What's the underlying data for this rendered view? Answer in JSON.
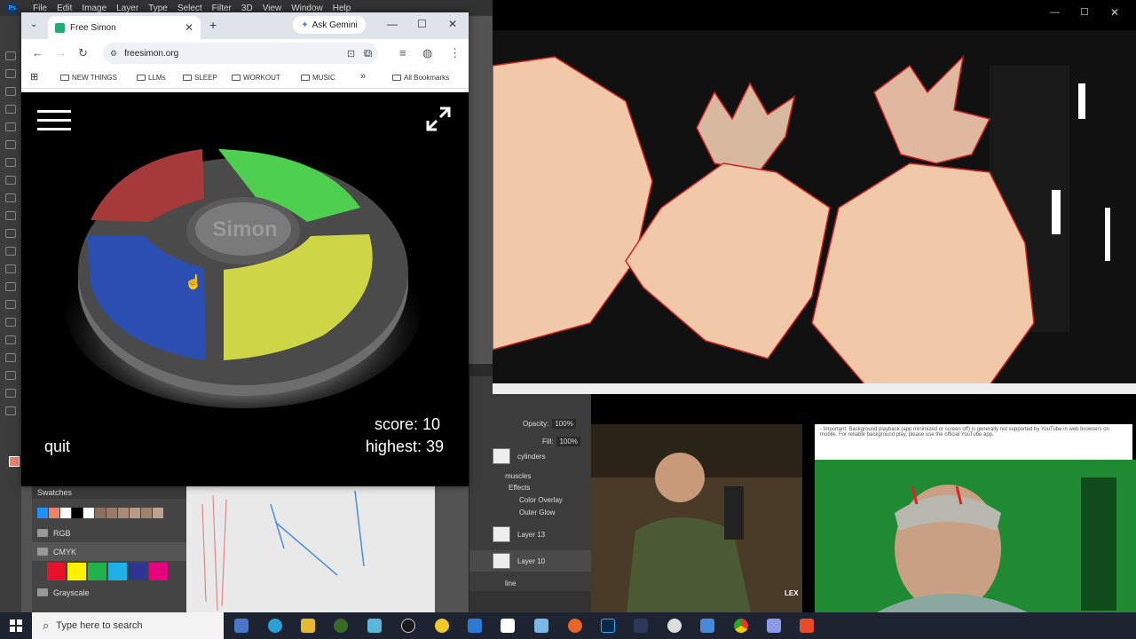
{
  "ps": {
    "menu": [
      "File",
      "Edit",
      "Image",
      "Layer",
      "Type",
      "Select",
      "Filter",
      "3D",
      "View",
      "Window",
      "Help"
    ],
    "swatches_title": "Swatches",
    "groups": [
      "RGB",
      "CMYK",
      "Grayscale"
    ],
    "layers": {
      "opacity_label": "Opacity:",
      "opacity_value": "100%",
      "fill_label": "Fill:",
      "fill_value": "100%",
      "items": [
        "cylinders",
        "muscles",
        "Effects",
        "Color Overlay",
        "Outer Glow",
        "Layer 13",
        "Layer 10",
        "line"
      ]
    }
  },
  "chrome": {
    "tab_title": "Free Simon",
    "gemini_label": "Ask Gemini",
    "url": "freesimon.org",
    "bookmarks": [
      "NEW THINGS",
      "LLMs",
      "SLEEP",
      "WORKOUT",
      "MUSIC"
    ],
    "all_bookmarks": "All Bookmarks"
  },
  "game": {
    "center_label": "Simon",
    "score_text": "score: 10",
    "highest_text": "highest: 39",
    "quit_label": "quit",
    "colors": {
      "red": "#a63a3a",
      "green": "#4fcf4f",
      "blue": "#2a4fb0",
      "yellow": "#cfd645"
    }
  },
  "video_text": "- Important: Background playback (app minimized or screen off) is generally not supported by YouTube in web browsers on mobile. For reliable background play, please use the official YouTube app.",
  "video2_label": "LEX",
  "taskbar": {
    "search_placeholder": "Type here to search"
  }
}
